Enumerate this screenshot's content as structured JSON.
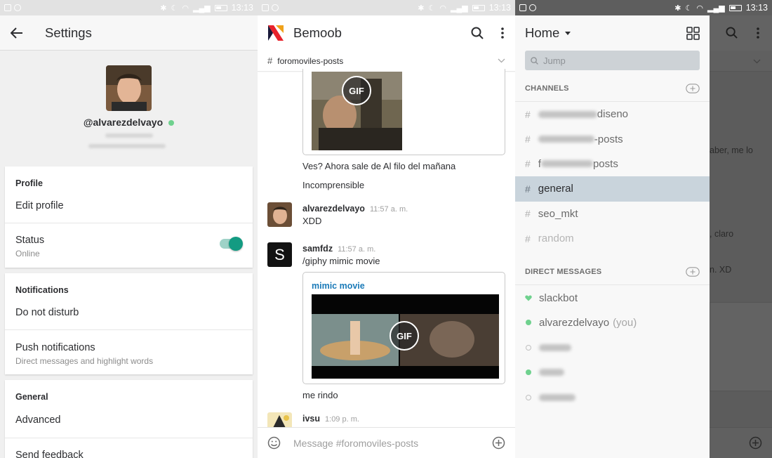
{
  "status": {
    "time": "13:13"
  },
  "settings": {
    "title": "Settings",
    "username": "@alvarezdelvayo",
    "profile": {
      "heading": "Profile",
      "edit": "Edit profile"
    },
    "status": {
      "title": "Status",
      "value": "Online",
      "enabled": true
    },
    "notifications": {
      "heading": "Notifications",
      "dnd": "Do not disturb",
      "push_title": "Push notifications",
      "push_sub": "Direct messages and highlight words"
    },
    "general": {
      "heading": "General",
      "advanced": "Advanced",
      "feedback": "Send feedback"
    }
  },
  "channel": {
    "team": "Bemoob",
    "name": "foromoviles-posts",
    "gif_badge": "GIF",
    "msg1": "Ves? Ahora sale de Al filo del mañana",
    "msg2": "Incomprensible",
    "post1": {
      "author": "alvarezdelvayo",
      "time": "11:57 a. m.",
      "text": "XDD"
    },
    "post2": {
      "author": "samfdz",
      "time": "11:57 a. m.",
      "text": "/giphy mimic movie",
      "avatar_letter": "S"
    },
    "link_title": "mimic movie",
    "msg3": "me rindo",
    "post3": {
      "author": "ivsu",
      "time": "1:09 p. m."
    },
    "composer_placeholder": "Message #foromoviles-posts"
  },
  "drawer": {
    "title": "Home",
    "jump": "Jump",
    "channels_head": "CHANNELS",
    "channels": [
      {
        "label": "diseno",
        "blur": 84
      },
      {
        "label": "-posts",
        "blur": 80
      },
      {
        "label": "posts",
        "blur": 78,
        "prefix": "f"
      },
      {
        "label": "general",
        "active": true
      },
      {
        "label": "seo_mkt"
      },
      {
        "label": "random",
        "muted": true
      }
    ],
    "dm_head": "DIRECT MESSAGES",
    "dms": [
      {
        "label": "slackbot",
        "heart": true
      },
      {
        "label": "alvarezdelvayo",
        "you": "(you)",
        "online": true
      }
    ],
    "behind": {
      "line1": "aber, me lo",
      "line2": ", claro",
      "line3": "n. XD"
    }
  },
  "colors": {
    "accent": "#139b82",
    "online": "#6fd18e",
    "link": "#1a7ab8",
    "active_row": "#c9d4dc"
  }
}
